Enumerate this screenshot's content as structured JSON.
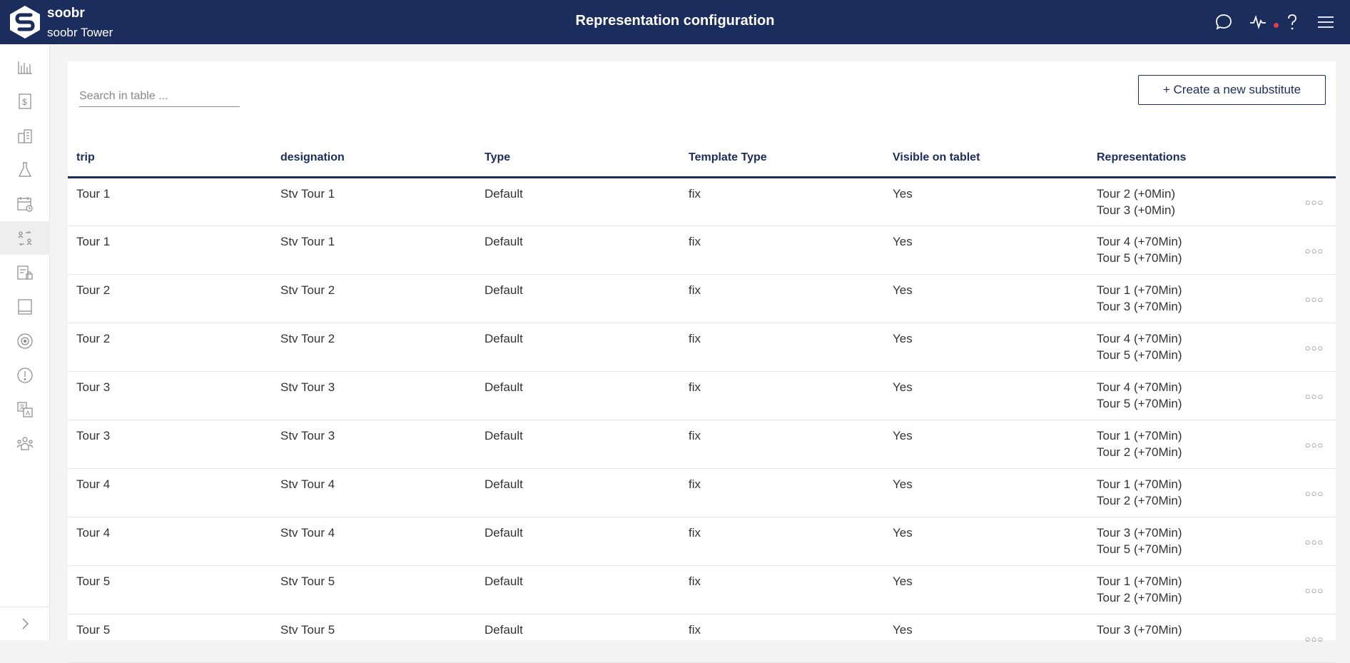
{
  "header": {
    "brand": "soobr",
    "subtitle": "soobr Tower",
    "title": "Representation configuration",
    "icons": [
      "chat-icon",
      "activity-icon",
      "help-icon",
      "menu-icon"
    ],
    "accent_color": "#1b2d5c",
    "notification_dot_color": "#e53950"
  },
  "sidebar": {
    "items": [
      {
        "icon": "chart-bars-icon",
        "active": false
      },
      {
        "icon": "dollar-document-icon",
        "active": false
      },
      {
        "icon": "buildings-icon",
        "active": false
      },
      {
        "icon": "flask-icon",
        "active": false
      },
      {
        "icon": "calendar-clock-icon",
        "active": false
      },
      {
        "icon": "people-swap-icon",
        "active": true
      },
      {
        "icon": "report-lock-icon",
        "active": false
      },
      {
        "icon": "tablet-icon",
        "active": false
      },
      {
        "icon": "target-icon",
        "active": false
      },
      {
        "icon": "alert-icon",
        "active": false
      },
      {
        "icon": "translate-icon",
        "active": false
      },
      {
        "icon": "team-icon",
        "active": false
      }
    ],
    "collapse_icon": "chevron-right-icon"
  },
  "toolbar": {
    "search_placeholder": "Search in table ...",
    "search_value": "",
    "create_label": "+ Create a new substitute"
  },
  "table": {
    "columns": [
      "trip",
      "designation",
      "Type",
      "Template Type",
      "Visible on tablet",
      "Representations"
    ],
    "rows": [
      {
        "trip": "Tour 1",
        "designation": "Stv Tour 1",
        "type": "Default",
        "template_type": "fix",
        "visible": "Yes",
        "rep1": "Tour 2 (+0Min)",
        "rep2": "Tour 3 (+0Min)"
      },
      {
        "trip": "Tour 1",
        "designation": "Stv Tour 1",
        "type": "Default",
        "template_type": "fix",
        "visible": "Yes",
        "rep1": "Tour 4 (+70Min)",
        "rep2": "Tour 5 (+70Min)"
      },
      {
        "trip": "Tour 2",
        "designation": "Stv Tour 2",
        "type": "Default",
        "template_type": "fix",
        "visible": "Yes",
        "rep1": "Tour 1 (+70Min)",
        "rep2": "Tour 3 (+70Min)"
      },
      {
        "trip": "Tour 2",
        "designation": "Stv Tour 2",
        "type": "Default",
        "template_type": "fix",
        "visible": "Yes",
        "rep1": "Tour 4 (+70Min)",
        "rep2": "Tour 5 (+70Min)"
      },
      {
        "trip": "Tour 3",
        "designation": "Stv Tour 3",
        "type": "Default",
        "template_type": "fix",
        "visible": "Yes",
        "rep1": "Tour 4 (+70Min)",
        "rep2": "Tour 5 (+70Min)"
      },
      {
        "trip": "Tour 3",
        "designation": "Stv Tour 3",
        "type": "Default",
        "template_type": "fix",
        "visible": "Yes",
        "rep1": "Tour 1 (+70Min)",
        "rep2": "Tour 2 (+70Min)"
      },
      {
        "trip": "Tour 4",
        "designation": "Stv Tour 4",
        "type": "Default",
        "template_type": "fix",
        "visible": "Yes",
        "rep1": "Tour 1 (+70Min)",
        "rep2": "Tour 2 (+70Min)"
      },
      {
        "trip": "Tour 4",
        "designation": "Stv Tour 4",
        "type": "Default",
        "template_type": "fix",
        "visible": "Yes",
        "rep1": "Tour 3 (+70Min)",
        "rep2": "Tour 5 (+70Min)"
      },
      {
        "trip": "Tour 5",
        "designation": "Stv Tour 5",
        "type": "Default",
        "template_type": "fix",
        "visible": "Yes",
        "rep1": "Tour 1 (+70Min)",
        "rep2": "Tour 2 (+70Min)"
      },
      {
        "trip": "Tour 5",
        "designation": "Stv Tour 5",
        "type": "Default",
        "template_type": "fix",
        "visible": "Yes",
        "rep1": "Tour 3 (+70Min)",
        "rep2": ""
      }
    ],
    "row_action_icon": "more-options-icon"
  }
}
